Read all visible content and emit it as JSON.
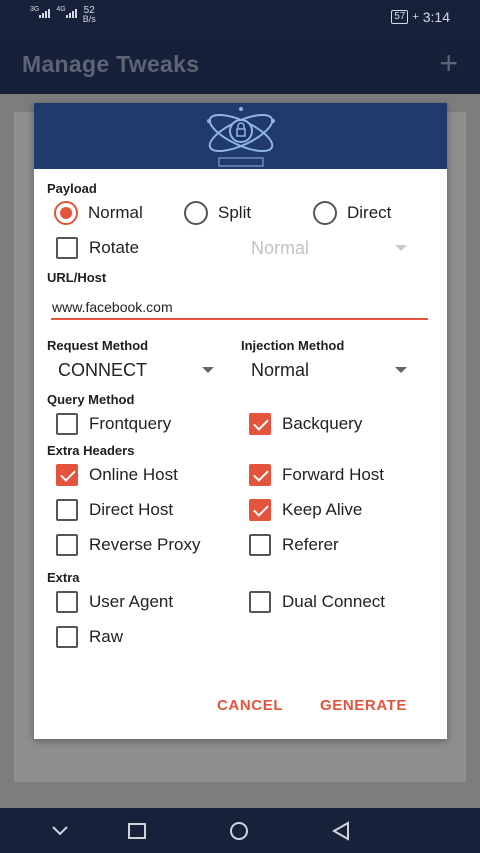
{
  "status": {
    "sim1": "3G",
    "sim2": "4G",
    "speed_value": "52",
    "speed_unit": "B/s",
    "battery": "57",
    "time": "3:14"
  },
  "appbar": {
    "title": "Manage Tweaks",
    "add_icon": "plus-icon"
  },
  "dialog": {
    "payload": {
      "label": "Payload",
      "options": [
        "Normal",
        "Split",
        "Direct"
      ],
      "selected": "Normal",
      "rotate_label": "Rotate",
      "rotate_checked": false,
      "rotate_dropdown_value": "Normal"
    },
    "url": {
      "label": "URL/Host",
      "value": "www.facebook.com"
    },
    "request_method": {
      "label": "Request Method",
      "value": "CONNECT"
    },
    "injection_method": {
      "label": "Injection Method",
      "value": "Normal"
    },
    "query_method": {
      "label": "Query Method",
      "items": [
        {
          "label": "Frontquery",
          "checked": false
        },
        {
          "label": "Backquery",
          "checked": true
        }
      ]
    },
    "extra_headers": {
      "label": "Extra Headers",
      "items": [
        {
          "label": "Online Host",
          "checked": true
        },
        {
          "label": "Forward Host",
          "checked": true
        },
        {
          "label": "Direct Host",
          "checked": false
        },
        {
          "label": "Keep Alive",
          "checked": true
        },
        {
          "label": "Reverse Proxy",
          "checked": false
        },
        {
          "label": "Referer",
          "checked": false
        }
      ]
    },
    "extra": {
      "label": "Extra",
      "items": [
        {
          "label": "User Agent",
          "checked": false
        },
        {
          "label": "Dual Connect",
          "checked": false
        },
        {
          "label": "Raw",
          "checked": false
        }
      ]
    },
    "buttons": {
      "cancel": "CANCEL",
      "generate": "GENERATE"
    }
  },
  "colors": {
    "accent": "#e5533d",
    "header": "#203a6d",
    "appbar": "#162039"
  }
}
